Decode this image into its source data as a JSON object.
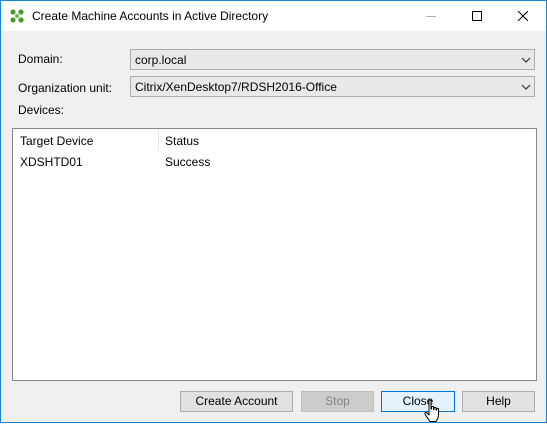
{
  "window": {
    "title": "Create Machine Accounts in Active Directory"
  },
  "form": {
    "domain_label": "Domain:",
    "domain_value": "corp.local",
    "ou_label": "Organization unit:",
    "ou_value": "Citrix/XenDesktop7/RDSH2016-Office",
    "devices_label": "Devices:"
  },
  "devices": {
    "columns": [
      "Target Device",
      "Status"
    ],
    "rows": [
      {
        "device": "XDSHTD01",
        "status": "Success"
      }
    ]
  },
  "buttons": {
    "create": "Create Account",
    "stop": "Stop",
    "close": "Close",
    "help": "Help"
  },
  "icons": {
    "app": "citrix-app-icon",
    "minimize": "minimize-icon",
    "maximize": "maximize-icon",
    "close": "close-icon",
    "dropdown": "chevron-down-icon",
    "cursor": "hand-pointer-cursor"
  }
}
